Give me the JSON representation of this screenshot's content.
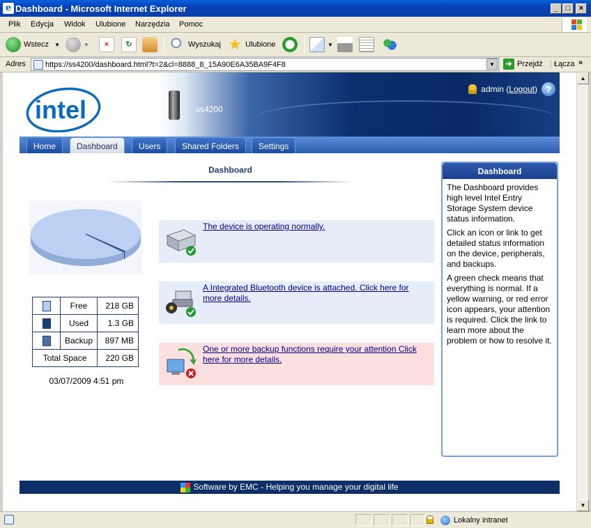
{
  "window": {
    "title": "Dashboard - Microsoft Internet Explorer"
  },
  "menu": [
    "Plik",
    "Edycja",
    "Widok",
    "Ulubione",
    "Narzędzia",
    "Pomoc"
  ],
  "toolbar": {
    "back": "Wstecz",
    "search": "Wyszukaj",
    "favorites": "Ulubione"
  },
  "address": {
    "label": "Adres",
    "url": "https://ss4200/dashboard.html?t=2&cl=8888_8_15A90E6A35BA9F4F8",
    "go": "Przejdź",
    "links": "Łącza"
  },
  "header": {
    "device_name": "ss4200",
    "user": "admin",
    "logout_open": "(",
    "logout": "Logout",
    "logout_close": ")"
  },
  "nav": {
    "tabs": [
      "Home",
      "Dashboard",
      "Users",
      "Shared Folders",
      "Settings"
    ],
    "active": "Dashboard"
  },
  "main": {
    "title": "Dashboard"
  },
  "storage": {
    "rows": [
      {
        "label": "Free",
        "value": "218 GB",
        "color": "#b8cef0"
      },
      {
        "label": "Used",
        "value": "1.3 GB",
        "color": "#1f3e73"
      },
      {
        "label": "Backup",
        "value": "897 MB",
        "color": "#4f6fa8"
      },
      {
        "label": "Total Space",
        "value": "220 GB"
      }
    ],
    "timestamp": "03/07/2009 4:51 pm"
  },
  "statuses": [
    {
      "text": "The device is operating normally.",
      "level": "ok",
      "bg": "#e6ecf8"
    },
    {
      "text": "A Integrated Bluetooth device is attached. Click here for more details.",
      "level": "ok",
      "bg": "#e6ecf8"
    },
    {
      "text": "One or more backup functions require your attention Click here for more details.",
      "level": "error",
      "bg": "#fce0e0"
    }
  ],
  "help": {
    "title": "Dashboard",
    "paragraphs": [
      "The Dashboard provides high level Intel Entry Storage System device status information.",
      "Click an icon or link to get detailed status information on the device, peripherals, and backups.",
      "A green check means that everything is normal. If a yellow warning, or red error icon appears, your attention is required. Click the link to learn more about the problem or how to resolve it."
    ]
  },
  "footer": {
    "text": "Software by EMC - Helping you manage your digital life"
  },
  "statusbar": {
    "zone": "Lokalny intranet"
  }
}
